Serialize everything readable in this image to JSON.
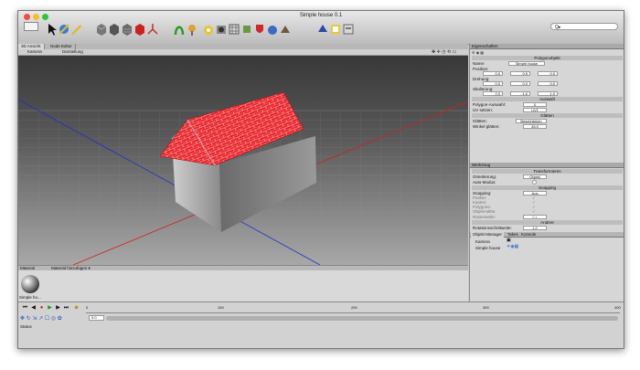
{
  "window": {
    "title": "Simple house 0.1"
  },
  "search": {
    "placeholder": "Q▸"
  },
  "viewport": {
    "tabs": [
      {
        "label": "3D Ansicht"
      },
      {
        "label": "Node Editor"
      }
    ],
    "menu": [
      {
        "label": "Kamera"
      },
      {
        "label": "Darstellung"
      }
    ]
  },
  "properties": {
    "header": "Eigenschaften",
    "section_object": "Polygonobjekt",
    "name_label": "Name:",
    "name_value": "Simple house",
    "position_label": "Position:",
    "position": [
      "0.0",
      "0.5",
      "0.0"
    ],
    "rotation_label": "Drehung:",
    "rotation": [
      "0.0",
      "0.0",
      "0.0"
    ],
    "scale_label": "Skalierung:",
    "scale": [
      "2.0",
      "1.0",
      "1.0"
    ],
    "section_selection": "Auswahl",
    "poly_sel_label": "Polygon-Auswahl:",
    "poly_sel_value": "0",
    "uv_label": "UV setzen:",
    "uv_value": "UV1",
    "section_smooth": "Glätten",
    "smooth_label": "Glätten:",
    "smooth_value": "Beschränken",
    "angle_label": "Winkel glätten:",
    "angle_value": "45.0"
  },
  "tool": {
    "header": "Werkzeug",
    "section_transform": "Transformieren",
    "orient_label": "Orientierung:",
    "orient_value": "Objekt",
    "auto_label": "Auto-Modus:",
    "section_snapping": "Snapping",
    "snapping_label": "Snapping:",
    "snapping_value": "Aus",
    "points_label": "Punkte:",
    "edges_label": "Kanten:",
    "polygons_label": "Polygone:",
    "object_center_label": "Objekt-Mitte:",
    "grid_width_label": "Rasterweite:",
    "grid_width_value": "0.1",
    "section_other": "Andere",
    "rot_step_label": "Rotationsschrittweite:",
    "rot_step_value": "1.0"
  },
  "objects": {
    "tabs": [
      {
        "label": "Objekt Manager"
      },
      {
        "label": "Takes"
      },
      {
        "label": "Konsole"
      }
    ],
    "items": [
      {
        "label": "Kamera"
      },
      {
        "label": "Simple house"
      }
    ]
  },
  "material": {
    "header": "Material",
    "menu": "Material hinzufügen ▾",
    "items": [
      {
        "label": "Simple ho..."
      }
    ]
  },
  "timeline": {
    "frame_value": "0.0",
    "ticks": [
      "0",
      "100",
      "200",
      "300",
      "400"
    ],
    "status": "Status"
  },
  "colors": {
    "roof": "#e8242a",
    "axis_x": "#d02020",
    "axis_z": "#2030c8"
  }
}
